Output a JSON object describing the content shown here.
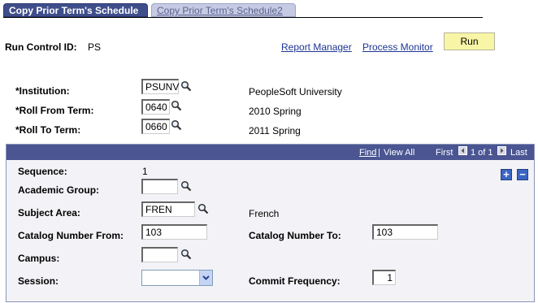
{
  "tabs": [
    {
      "label": "Copy Prior Term's Schedule",
      "active": true
    },
    {
      "label": "Copy Prior Term's Schedule2",
      "active": false
    }
  ],
  "run_control": {
    "label": "Run Control ID:",
    "value": "PS"
  },
  "links": {
    "report_manager": "Report Manager",
    "process_monitor": "Process Monitor"
  },
  "run_label": "Run",
  "form": {
    "institution": {
      "label": "*Institution:",
      "value": "PSUNV",
      "description": "PeopleSoft University"
    },
    "roll_from": {
      "label": "*Roll From Term:",
      "value": "0640",
      "description": "2010 Spring"
    },
    "roll_to": {
      "label": "*Roll To Term:",
      "value": "0660",
      "description": "2011 Spring"
    }
  },
  "grid": {
    "find": "Find",
    "sep": "|",
    "view_all": "View All",
    "first": "First",
    "count": "1 of 1",
    "last": "Last",
    "sequence": {
      "label": "Sequence:",
      "value": "1"
    },
    "academic_group": {
      "label": "Academic Group:",
      "value": ""
    },
    "subject_area": {
      "label": "Subject Area:",
      "value": "FREN",
      "description": "French"
    },
    "catalog_from": {
      "label": "Catalog Number From:",
      "value": "103"
    },
    "catalog_to": {
      "label": "Catalog Number To:",
      "value": "103"
    },
    "campus": {
      "label": "Campus:",
      "value": ""
    },
    "session": {
      "label": "Session:",
      "value": ""
    },
    "commit_frequency": {
      "label": "Commit Frequency:",
      "value": "1"
    },
    "add_symbol": "+",
    "delete_symbol": "−"
  },
  "icons": {
    "lookup": "magnifier-icon"
  },
  "colors": {
    "tab_active": "#3f4e8b",
    "grid_header": "#4a5592",
    "run_button": "#f8f6a6",
    "link": "#1d3593"
  }
}
